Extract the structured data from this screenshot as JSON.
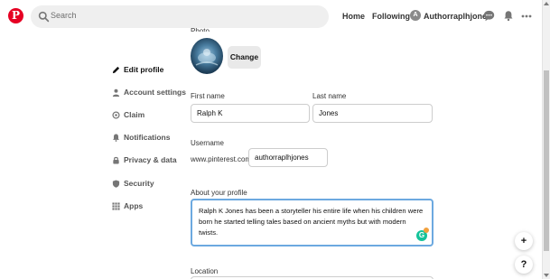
{
  "header": {
    "search_placeholder": "Search",
    "nav": {
      "home": "Home",
      "following": "Following",
      "username": "Authorraplhjones",
      "avatar_initial": "A"
    },
    "icons": [
      "pinterest-logo",
      "search-icon",
      "messages-icon",
      "notifications-icon",
      "more-icon"
    ],
    "brand_color": "#e60023"
  },
  "sidebar": {
    "items": [
      {
        "label": "Edit profile",
        "icon": "pencil-icon",
        "active": true
      },
      {
        "label": "Account settings",
        "icon": "person-icon"
      },
      {
        "label": "Claim",
        "icon": "at-icon"
      },
      {
        "label": "Notifications",
        "icon": "bell-icon"
      },
      {
        "label": "Privacy & data",
        "icon": "lock-icon"
      },
      {
        "label": "Security",
        "icon": "shield-icon"
      },
      {
        "label": "Apps",
        "icon": "grid-icon"
      }
    ]
  },
  "profile": {
    "photo_label": "Photo",
    "change_button": "Change",
    "first_name_label": "First name",
    "first_name_value": "Ralph K",
    "last_name_label": "Last name",
    "last_name_value": "Jones",
    "username_label": "Username",
    "url_prefix": "www.pinterest.com/",
    "username_value": "authorraplhjones",
    "about_label": "About your profile",
    "about_value": "Ralph K Jones has been a storyteller his entire life when his children were born he started telling tales based on ancient myths but with modern twists.",
    "location_label": "Location",
    "focus_color": "#6ca9e0"
  },
  "floating": {
    "add": "+",
    "help": "?"
  }
}
